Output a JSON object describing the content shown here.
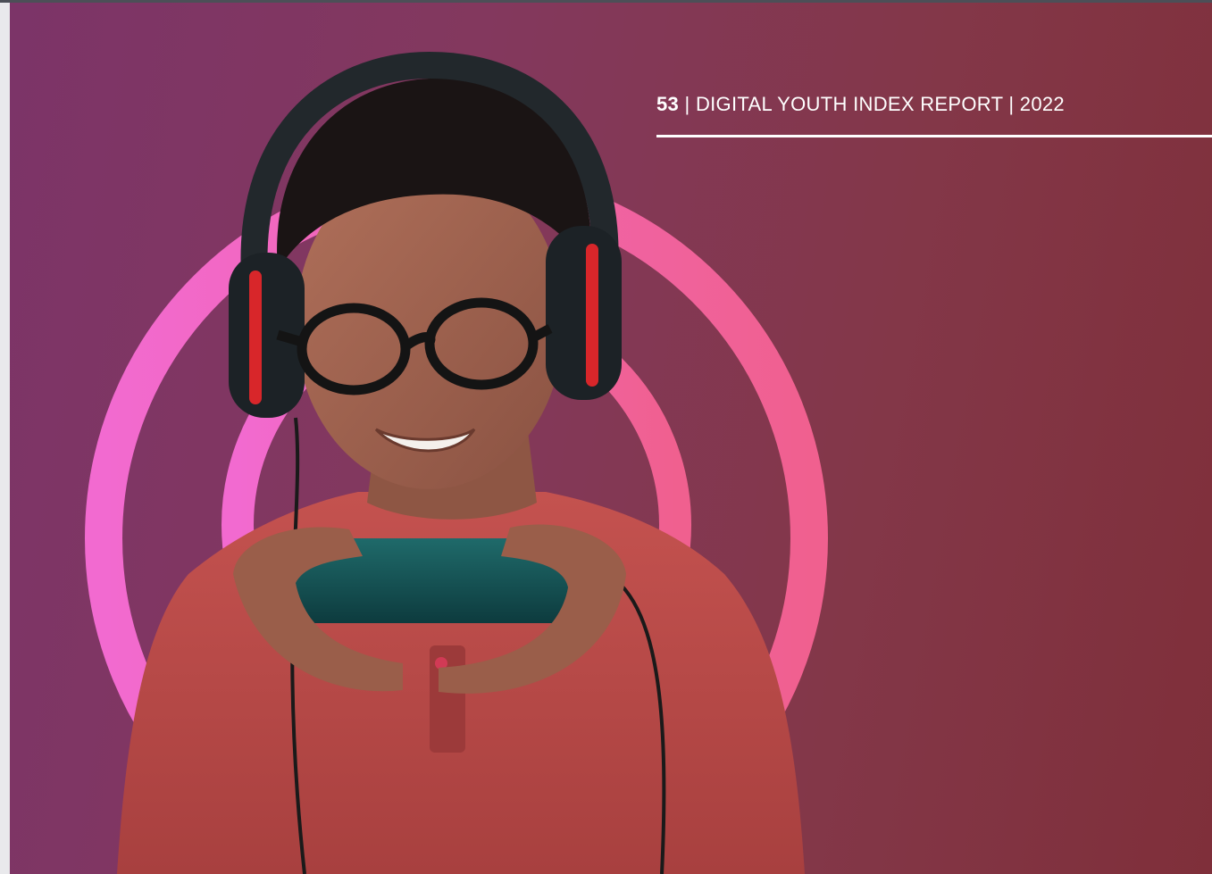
{
  "page": {
    "page_number": "53",
    "separator": "|",
    "report_title": "DIGITAL YOUTH INDEX REPORT",
    "year": "2022"
  },
  "colors": {
    "background_left": "#7c3468",
    "background_right": "#7f2f3a",
    "ring_pink": "#f064b4",
    "header_text": "#ffffff"
  },
  "photo": {
    "subject": "smiling boy wearing headphones and glasses playing a game on a smartphone",
    "icon": "photo-icon"
  }
}
